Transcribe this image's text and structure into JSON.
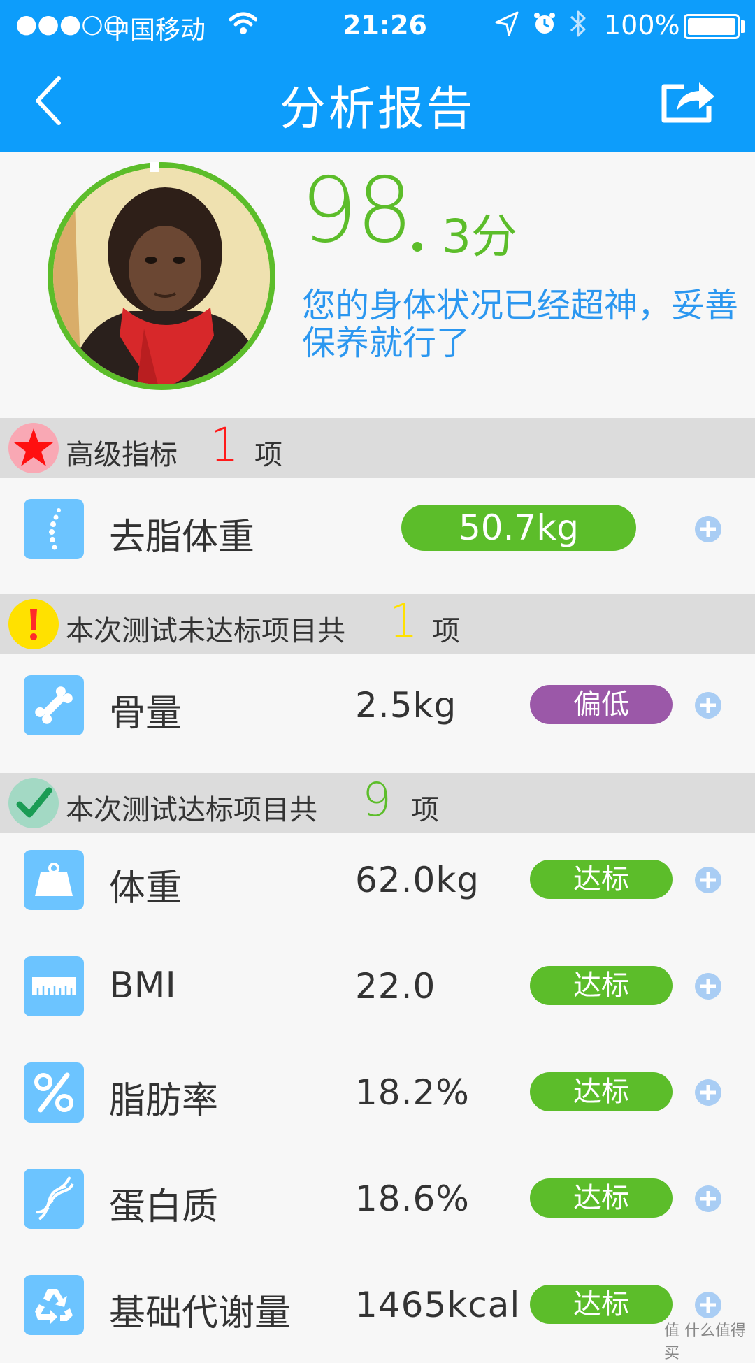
{
  "status_bar": {
    "signal": "●●●○○",
    "carrier": "中国移动",
    "time": "21:26",
    "battery": "100%"
  },
  "nav": {
    "title": "分析报告",
    "back_icon": "chevron-left-icon",
    "share_icon": "share-icon"
  },
  "profile": {
    "score_int": "98",
    "score_frac": "3分",
    "description": "您的身体状况已经超神，妥善保养就行了"
  },
  "sections": {
    "advanced": {
      "label": "高级指标",
      "count": "1",
      "unit": "项",
      "color": "#ff1a1a"
    },
    "failed": {
      "label": "本次测试未达标项目共",
      "count": "1",
      "unit": "项",
      "color": "#ffe100"
    },
    "passed": {
      "label": "本次测试达标项目共",
      "count": "9",
      "unit": "项",
      "color": "#5cbd2a"
    }
  },
  "advanced_rows": [
    {
      "name": "去脂体重",
      "value": "50.7kg",
      "icon": "spine-icon"
    }
  ],
  "failed_rows": [
    {
      "name": "骨量",
      "value": "2.5kg",
      "status": "偏低",
      "status_color": "#9b58a8",
      "icon": "bone-icon"
    }
  ],
  "passed_rows": [
    {
      "name": "体重",
      "value": "62.0kg",
      "status": "达标",
      "icon": "weight-icon"
    },
    {
      "name": "BMI",
      "value": "22.0",
      "status": "达标",
      "icon": "ruler-icon"
    },
    {
      "name": "脂肪率",
      "value": "18.2%",
      "status": "达标",
      "icon": "percent-icon"
    },
    {
      "name": "蛋白质",
      "value": "18.6%",
      "status": "达标",
      "icon": "dna-icon"
    },
    {
      "name": "基础代谢量",
      "value": "1465kcal",
      "status": "达标",
      "icon": "recycle-icon"
    }
  ],
  "colors": {
    "header": "#0d9dfb",
    "green": "#5cbd2a",
    "blue_text": "#2b97f0",
    "icon_bg": "#6cc4ff"
  },
  "watermark": "值 什么值得买"
}
